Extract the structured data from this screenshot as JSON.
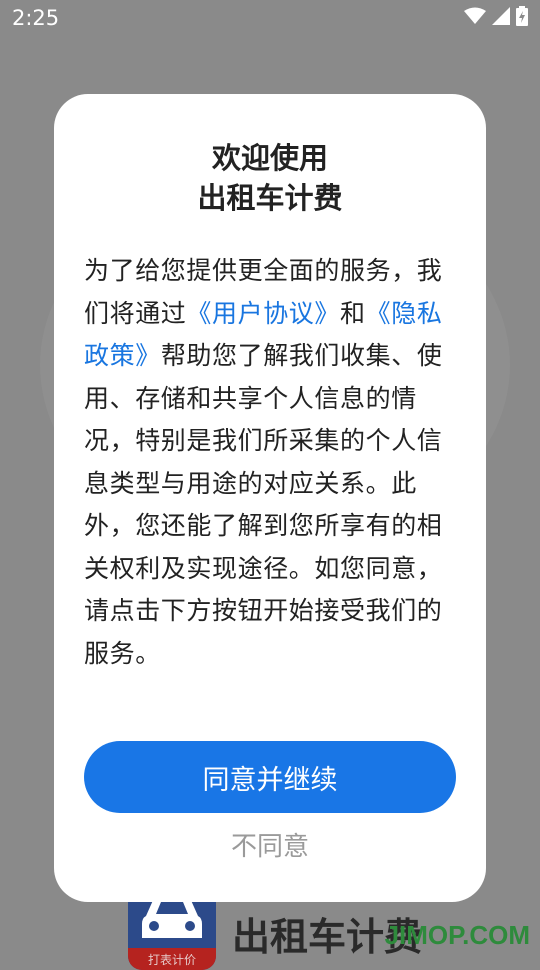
{
  "status_bar": {
    "time": "2:25",
    "icons": [
      "wifi-icon",
      "cellular-signal-icon",
      "battery-charging-icon"
    ]
  },
  "dialog": {
    "title_line1": "欢迎使用",
    "title_line2": "出租车计费",
    "body": {
      "part1": "为了给您提供更全面的服务，我们将通过",
      "link_user_agreement": "《用户协议》",
      "part2": "和",
      "link_privacy_policy": "《隐私政策》",
      "part3": "帮助您了解我们收集、使用、存储和共享个人信息的情况，特别是我们所采集的个人信息类型与用途的对应关系。此外，您还能了解到您所享有的相关权利及实现途径。如您同意，请点击下方按钮开始接受我们的服务。"
    },
    "agree_label": "同意并继续",
    "disagree_label": "不同意"
  },
  "background": {
    "app_name": "出租车计费",
    "logo_text": "打表计价",
    "watermark": "JIMOP.COM"
  },
  "colors": {
    "accent": "#1976e6",
    "link": "#1976e0",
    "overlay": "#8a8a8a",
    "watermark": "#2e8b3c"
  }
}
